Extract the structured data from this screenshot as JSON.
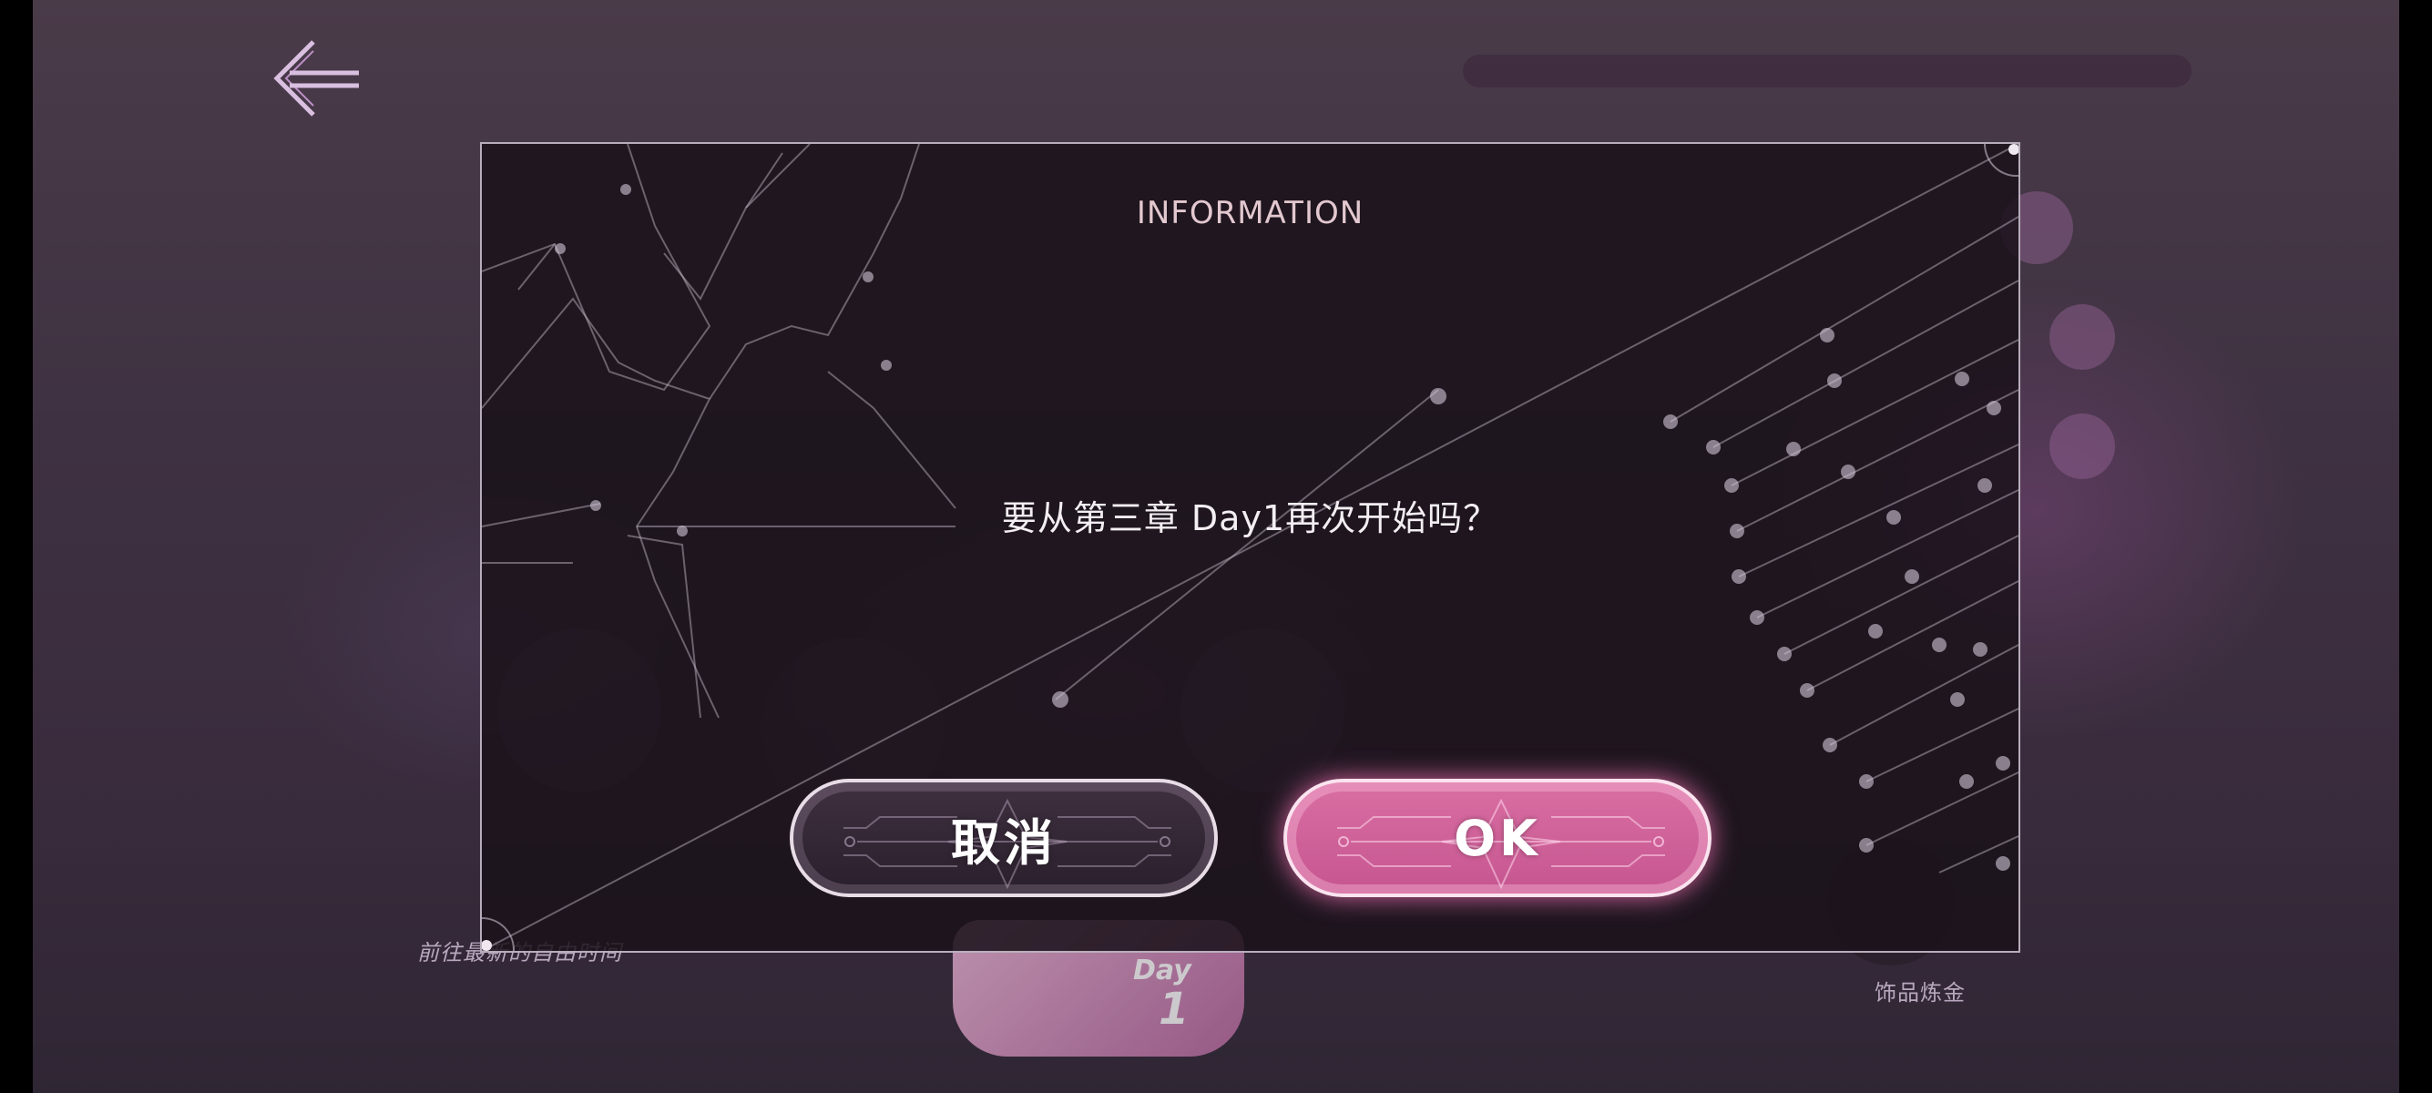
{
  "dialog": {
    "title": "INFORMATION",
    "message": "要从第三章 Day1再次开始吗？",
    "cancel_label": "取消",
    "ok_label": "OK"
  },
  "background": {
    "left_caption": "前往最新的自由时间",
    "right_caption": "饰品炼金",
    "day_card_word": "Day",
    "day_card_number": "1"
  },
  "icons": {
    "back": "back-arrow-icon"
  },
  "colors": {
    "ok_button": "#d96fa3",
    "cancel_button": "#3f3040",
    "dialog_border": "#d2c8d7",
    "title_text": "#e3c8cf"
  }
}
